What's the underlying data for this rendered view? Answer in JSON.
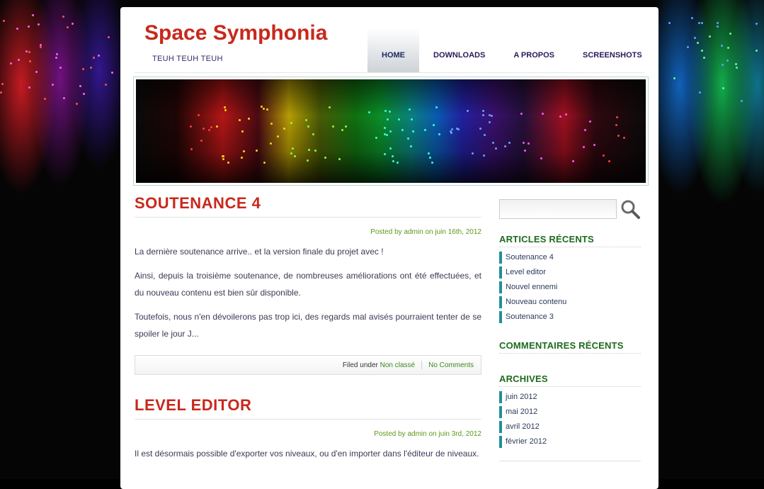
{
  "site": {
    "title": "Space Symphonia",
    "tagline": "TEUH TEUH TEUH"
  },
  "nav": {
    "items": [
      "HOME",
      "DOWNLOADS",
      "A PROPOS",
      "SCREENSHOTS"
    ],
    "active": "HOME"
  },
  "posts": [
    {
      "title": "SOUTENANCE 4",
      "meta_prefix": "Posted by",
      "author": "admin",
      "meta_on": "on",
      "date": "juin 16th, 2012",
      "paragraphs": [
        "La dernière soutenance arrive.. et la version finale du projet avec !",
        "Ainsi, depuis la troisième soutenance, de nombreuses améliorations ont été effectuées, et du nouveau contenu est bien sûr disponible.",
        "Toutefois, nous n'en dévoilerons pas trop ici, des regards mal avisés pourraient tenter de se spoiler le jour J..."
      ],
      "filed_under_label": "Filed under",
      "category": "Non classé",
      "comments": "No Comments"
    },
    {
      "title": "LEVEL EDITOR",
      "meta_prefix": "Posted by",
      "author": "admin",
      "meta_on": "on",
      "date": "juin 3rd, 2012",
      "paragraphs": [
        "Il est désormais possible d'exporter vos niveaux, ou d'en importer dans l'éditeur de niveaux."
      ]
    }
  ],
  "sidebar": {
    "recent_posts": {
      "title": "ARTICLES RÉCENTS",
      "items": [
        "Soutenance 4",
        "Level editor",
        "Nouvel ennemi",
        "Nouveau contenu",
        "Soutenance 3"
      ]
    },
    "recent_comments": {
      "title": "COMMENTAIRES RÉCENTS"
    },
    "archives": {
      "title": "ARCHIVES",
      "items": [
        "juin 2012",
        "mai 2012",
        "avril 2012",
        "février 2012"
      ]
    }
  },
  "icons": {
    "search": "magnifier-icon"
  },
  "colors": {
    "title_red": "#c8281c",
    "widget_green": "#1e6a1e",
    "list_accent": "#1f8f9a",
    "meta_green": "#5a9a1a"
  }
}
